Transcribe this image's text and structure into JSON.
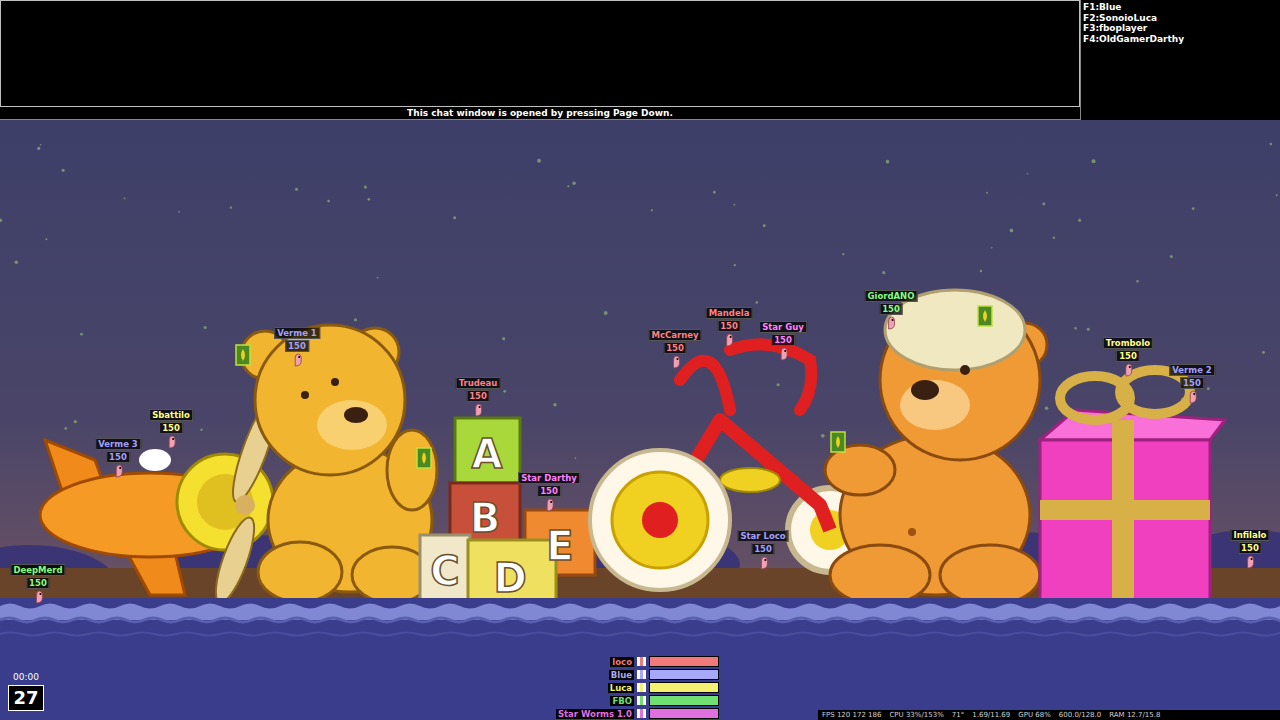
{
  "chat": {
    "hint": "This chat window is opened by pressing Page Down.",
    "players": [
      {
        "key": "F1:",
        "name": "Blue"
      },
      {
        "key": "F2:",
        "name": "SonoioLuca"
      },
      {
        "key": "F3:",
        "name": "fboplayer"
      },
      {
        "key": "F4:",
        "name": "OldGamerDarthy"
      }
    ]
  },
  "worms": [
    {
      "name": "Verme 1",
      "health": "150",
      "color": "#a0a0ff"
    },
    {
      "name": "Sbattilo",
      "health": "150",
      "color": "#ffff80"
    },
    {
      "name": "Verme 3",
      "health": "150",
      "color": "#a0a0ff"
    },
    {
      "name": "DeepMerd",
      "health": "150",
      "color": "#80ff80"
    },
    {
      "name": "Trudeau",
      "health": "150",
      "color": "#ff8080"
    },
    {
      "name": "Star Darthy",
      "health": "150",
      "color": "#ff80ff"
    },
    {
      "name": "McCarney",
      "health": "150",
      "color": "#ff8080"
    },
    {
      "name": "Mandela",
      "health": "150",
      "color": "#ff8080"
    },
    {
      "name": "Star Guy",
      "health": "150",
      "color": "#ff80ff"
    },
    {
      "name": "Star Loco",
      "health": "150",
      "color": "#a0a0ff"
    },
    {
      "name": "GiordANO",
      "health": "150",
      "color": "#80ff80"
    },
    {
      "name": "Trombolo",
      "health": "150",
      "color": "#ffff80"
    },
    {
      "name": "Verme 2",
      "health": "150",
      "color": "#a0a0ff"
    },
    {
      "name": "Infilalo",
      "health": "150",
      "color": "#ffff80"
    }
  ],
  "blocks": [
    "A",
    "B",
    "C",
    "D",
    "E"
  ],
  "teams": [
    {
      "name": "loco",
      "level": 1,
      "color": "#f07a7a"
    },
    {
      "name": "Blue",
      "level": 1,
      "color": "#a8a8f8"
    },
    {
      "name": "Luca",
      "level": 1,
      "color": "#f4f070"
    },
    {
      "name": "FBO",
      "level": 1,
      "color": "#70e070"
    },
    {
      "name": "Star Worms 1.0",
      "level": 1,
      "color": "#e070e0"
    }
  ],
  "timer": {
    "clock": "00:00",
    "turn": "27"
  },
  "stats": [
    "FPS 120 172 186",
    "CPU 33%/153%",
    "71°",
    "1.69/11.69",
    "GPU 68%",
    "600.0/128.0",
    "RAM 12.7/15.8"
  ]
}
